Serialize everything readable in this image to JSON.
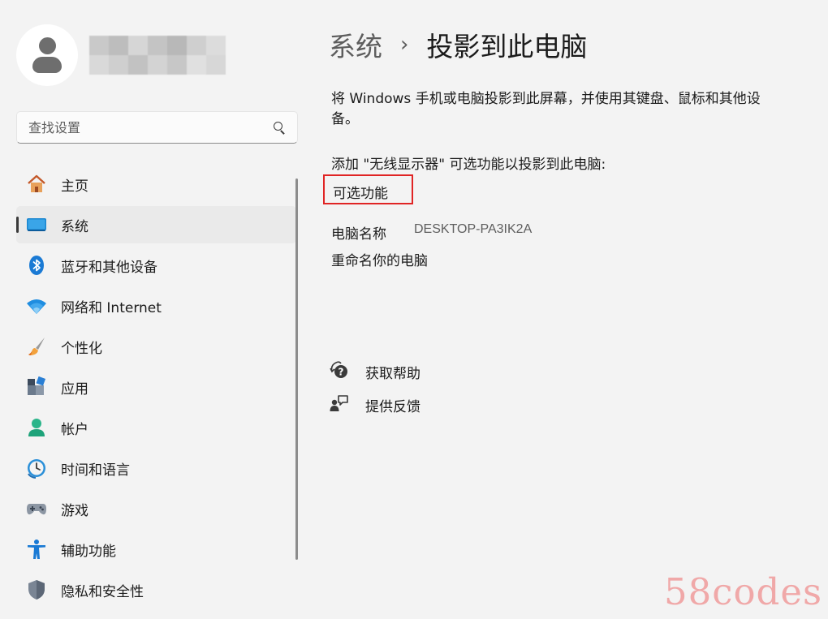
{
  "user": {
    "blur_colors": [
      "#c9c9c9",
      "#bdbdbd",
      "#d6d6d6",
      "#c4c4c4",
      "#b8b8b8",
      "#cfcfcf",
      "#dcdcdc",
      "#d9d9d9",
      "#cfcfcf",
      "#c2c2c2",
      "#d3d3d3",
      "#c7c7c7",
      "#e0e0e0",
      "#d7d7d7"
    ]
  },
  "search": {
    "placeholder": "查找设置"
  },
  "sidebar": {
    "items": [
      {
        "label": "主页",
        "icon": "home-icon"
      },
      {
        "label": "系统",
        "icon": "system-display-icon",
        "active": true
      },
      {
        "label": "蓝牙和其他设备",
        "icon": "bluetooth-icon"
      },
      {
        "label": "网络和 Internet",
        "icon": "wifi-icon"
      },
      {
        "label": "个性化",
        "icon": "paintbrush-icon"
      },
      {
        "label": "应用",
        "icon": "apps-icon"
      },
      {
        "label": "帐户",
        "icon": "account-icon"
      },
      {
        "label": "时间和语言",
        "icon": "time-language-icon"
      },
      {
        "label": "游戏",
        "icon": "gamepad-icon"
      },
      {
        "label": "辅助功能",
        "icon": "accessibility-icon"
      },
      {
        "label": "隐私和安全性",
        "icon": "shield-icon"
      }
    ]
  },
  "header": {
    "parent": "系统",
    "separator": "›",
    "current": "投影到此电脑"
  },
  "main": {
    "description": "将 Windows 手机或电脑投影到此屏幕，并使用其键盘、鼠标和其他设备。",
    "add_wireless_display": "添加 \"无线显示器\" 可选功能以投影到此电脑:",
    "optional_features_link": "可选功能",
    "pc_name_label": "电脑名称",
    "pc_name_value": "DESKTOP-PA3IK2A",
    "rename_link": "重命名你的电脑"
  },
  "help": {
    "get_help": "获取帮助",
    "give_feedback": "提供反馈"
  },
  "watermark": "58codes",
  "colors": {
    "background": "#f3f3f3",
    "accent": "#0067c0",
    "highlight_box": "#e02424",
    "watermark": "#f0a8a8"
  }
}
